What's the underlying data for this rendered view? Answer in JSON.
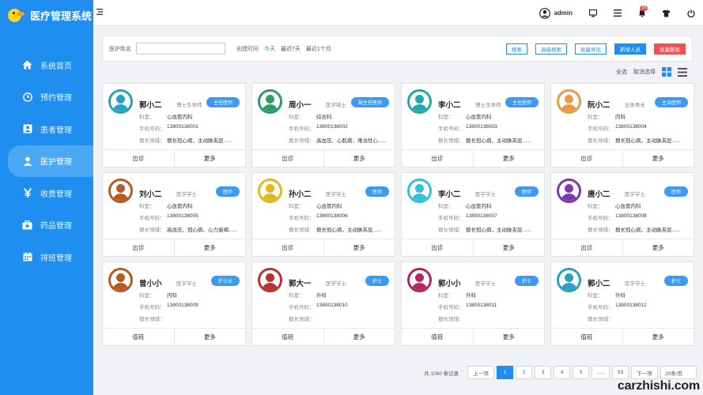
{
  "app": {
    "title": "医疗管理系统"
  },
  "sidebar": {
    "items": [
      {
        "label": "系统首页",
        "icon": "home-icon"
      },
      {
        "label": "预约管理",
        "icon": "clock-icon"
      },
      {
        "label": "患者管理",
        "icon": "person-card-icon"
      },
      {
        "label": "医护管理",
        "icon": "person-icon",
        "active": true
      },
      {
        "label": "收费管理",
        "icon": "yen-icon"
      },
      {
        "label": "药品管理",
        "icon": "medkit-icon"
      },
      {
        "label": "排班管理",
        "icon": "calendar-icon"
      }
    ]
  },
  "topbar": {
    "user": "admin",
    "notification_count": "10"
  },
  "filter": {
    "name_label": "医护姓名",
    "name_value": "",
    "created_label": "创建时间",
    "quick": [
      "今天",
      "最近7天",
      "最近1个月"
    ],
    "buttons": {
      "search": "搜索",
      "advanced": "高级搜索",
      "export": "批量导出",
      "add": "新增人员",
      "delete": "批量删除"
    }
  },
  "view": {
    "select_all": "全选",
    "deselect": "取消选择"
  },
  "field_labels": {
    "dept": "科室：",
    "phone": "手机号码：",
    "specialty": "擅长领域："
  },
  "cards": [
    {
      "name": "郭小二",
      "title": "博士生导师",
      "tag": "主任医师",
      "dept": "心血管内科",
      "phone": "13800138001",
      "specialty": "擅长冠心病，主动脉夹层......",
      "actions": [
        "出诊",
        "更多"
      ],
      "color": "#2aa1c0"
    },
    {
      "name": "周小一",
      "title": "医学硕士",
      "tag": "副主任医师",
      "dept": "综合科",
      "phone": "13800138002",
      "specialty": "高血压、心肌病、难治性心......",
      "actions": [
        "出诊",
        "更多"
      ],
      "color": "#2e9c6b"
    },
    {
      "name": "李小二",
      "title": "博士生导师",
      "tag": "主任医师",
      "dept": "心血管内科",
      "phone": "13800138003",
      "specialty": "擅长冠心病，主动脉夹层......",
      "actions": [
        "出诊",
        "更多"
      ],
      "color": "#22a9a9"
    },
    {
      "name": "阮小二",
      "title": "业务骨长",
      "tag": "主治医师",
      "dept": "内科",
      "phone": "13800138004",
      "specialty": "擅长冠心病，主动脉夹层......",
      "actions": [
        "出诊",
        "更多"
      ],
      "color": "#e99a45"
    },
    {
      "name": "刘小二",
      "title": "医学学士",
      "tag": "医师",
      "dept": "心血管内科",
      "phone": "13800138005",
      "specialty": "高血压、冠心病、心力衰竭......",
      "actions": [
        "出诊",
        "更多"
      ],
      "color": "#b85a24"
    },
    {
      "name": "孙小二",
      "title": "医学学士",
      "tag": "医师",
      "dept": "心血管内科",
      "phone": "13800138006",
      "specialty": "擅长冠心病，主动脉夹层......",
      "actions": [
        "出诊",
        "更多"
      ],
      "color": "#e2b81e"
    },
    {
      "name": "李小二",
      "title": "医学学士",
      "tag": "医师",
      "dept": "心血管内科",
      "phone": "13800138007",
      "specialty": "擅长冠心病，主动脉夹层......",
      "actions": [
        "出诊",
        "更多"
      ],
      "color": "#32c0dc"
    },
    {
      "name": "唐小二",
      "title": "医学学士",
      "tag": "医师",
      "dept": "心血管内科",
      "phone": "13800138008",
      "specialty": "擅长冠心病，主动脉夹层......",
      "actions": [
        "出诊",
        "更多"
      ],
      "color": "#7d3aa8"
    },
    {
      "name": "曾小小",
      "title": "医学学士",
      "tag": "护士长",
      "dept": "内科",
      "phone": "13800138009",
      "specialty": "",
      "actions": [
        "值班",
        "更多"
      ],
      "color": "#b85a24"
    },
    {
      "name": "郭大一",
      "title": "医学学士",
      "tag": "护士",
      "dept": "外科",
      "phone": "13800138010",
      "specialty": "",
      "actions": [
        "值班",
        "更多"
      ],
      "color": "#b83232"
    },
    {
      "name": "郭小小",
      "title": "医学学士",
      "tag": "护士",
      "dept": "外科",
      "phone": "13800138011",
      "specialty": "",
      "actions": [
        "值班",
        "更多"
      ],
      "color": "#b02860"
    },
    {
      "name": "郭小二",
      "title": "医学学士",
      "tag": "护士",
      "dept": "外科",
      "phone": "13800138012",
      "specialty": "",
      "actions": [
        "值班",
        "更多"
      ],
      "color": "#2aa1c0"
    }
  ],
  "pager": {
    "total_prefix": "共",
    "total": "1060",
    "total_suffix": "条记录",
    "prev": "上一项",
    "pages": [
      "1",
      "2",
      "3",
      "4",
      "5",
      "......",
      "53"
    ],
    "current": "1",
    "next": "下一项",
    "page_size": "20条/页"
  },
  "watermark": "carzhishi.com"
}
